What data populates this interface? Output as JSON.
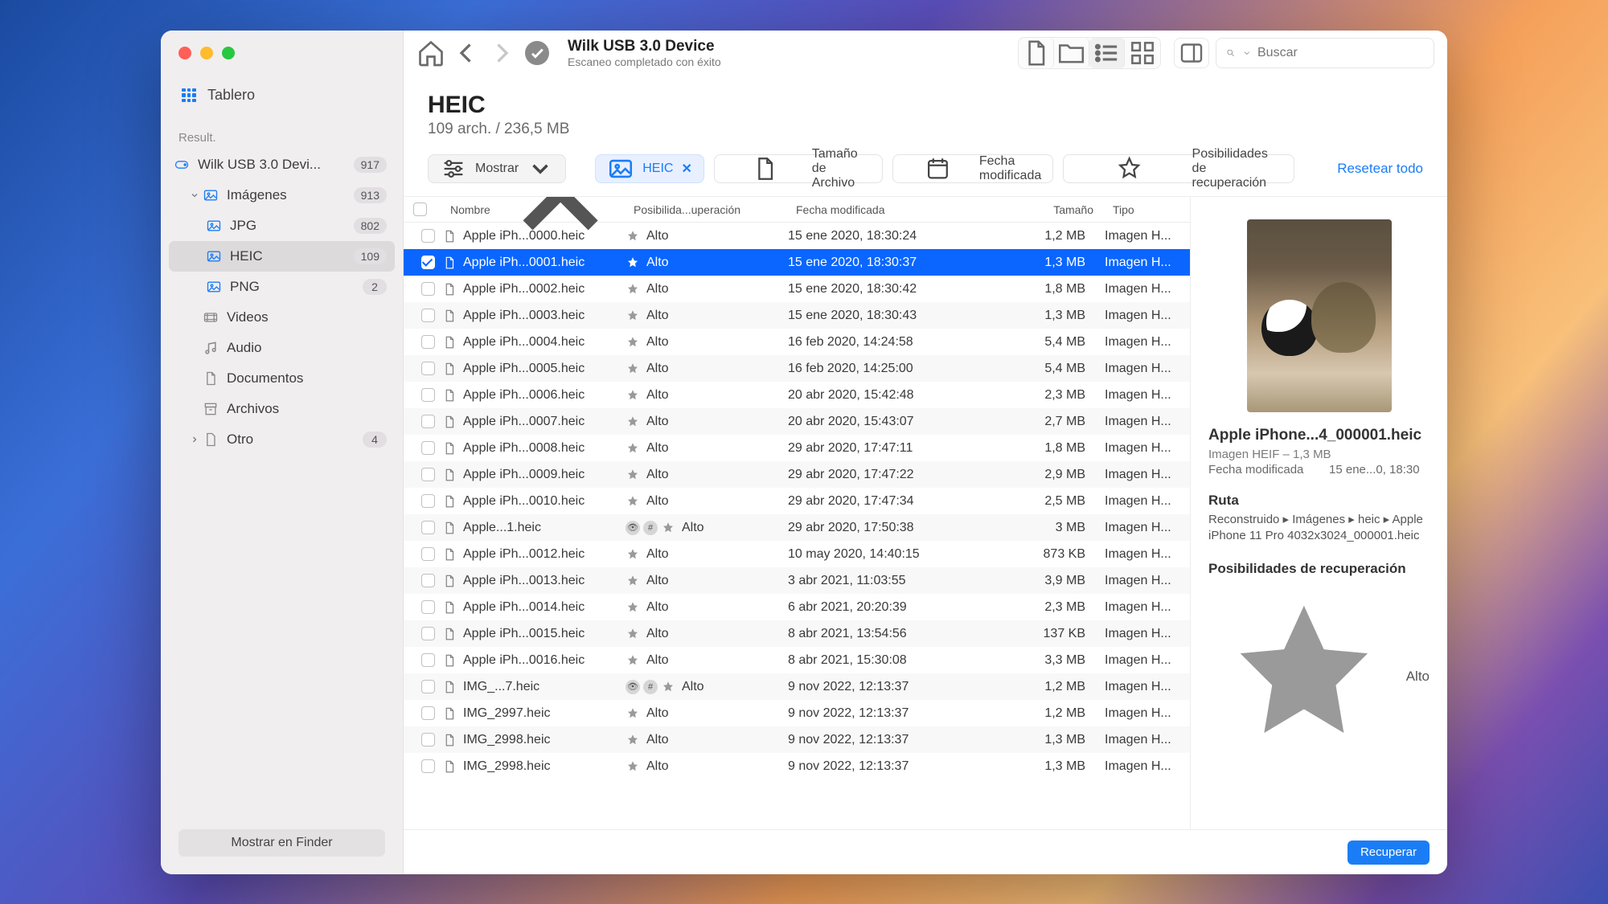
{
  "window": {
    "title": "Wilk USB 3.0 Device",
    "subtitle": "Escaneo completado con éxito",
    "search_placeholder": "Buscar"
  },
  "sidebar": {
    "tablero": "Tablero",
    "section": "Result.",
    "items": [
      {
        "label": "Wilk USB 3.0 Devi...",
        "badge": "917",
        "icon": "drive"
      },
      {
        "label": "Imágenes",
        "badge": "913",
        "icon": "image",
        "expanded": true
      },
      {
        "label": "JPG",
        "badge": "802",
        "icon": "image",
        "child": true
      },
      {
        "label": "HEIC",
        "badge": "109",
        "icon": "image",
        "child": true,
        "selected": true
      },
      {
        "label": "PNG",
        "badge": "2",
        "icon": "image",
        "child": true
      },
      {
        "label": "Videos",
        "badge": "",
        "icon": "video"
      },
      {
        "label": "Audio",
        "badge": "",
        "icon": "audio"
      },
      {
        "label": "Documentos",
        "badge": "",
        "icon": "doc"
      },
      {
        "label": "Archivos",
        "badge": "",
        "icon": "archive"
      },
      {
        "label": "Otro",
        "badge": "4",
        "icon": "other",
        "chevron": true
      }
    ],
    "finder_btn": "Mostrar en Finder"
  },
  "heading": {
    "title": "HEIC",
    "stats": "109 arch. / 236,5 MB"
  },
  "filters": {
    "mostrar": "Mostrar",
    "heic": "HEIC",
    "tamano": "Tamaño de Archivo",
    "fecha": "Fecha modificada",
    "posib": "Posibilidades de recuperación",
    "reset": "Resetear todo"
  },
  "columns": {
    "name": "Nombre",
    "poss": "Posibilida...uperación",
    "date": "Fecha modificada",
    "size": "Tamaño",
    "type": "Tipo"
  },
  "poss_label": "Alto",
  "type_label": "Imagen H...",
  "rows": [
    {
      "name": "Apple iPh...0000.heic",
      "date": "15 ene 2020, 18:30:24",
      "size": "1,2 MB"
    },
    {
      "name": "Apple iPh...0001.heic",
      "date": "15 ene 2020, 18:30:37",
      "size": "1,3 MB",
      "selected": true,
      "checked": true
    },
    {
      "name": "Apple iPh...0002.heic",
      "date": "15 ene 2020, 18:30:42",
      "size": "1,8 MB"
    },
    {
      "name": "Apple iPh...0003.heic",
      "date": "15 ene 2020, 18:30:43",
      "size": "1,3 MB"
    },
    {
      "name": "Apple iPh...0004.heic",
      "date": "16 feb 2020, 14:24:58",
      "size": "5,4 MB"
    },
    {
      "name": "Apple iPh...0005.heic",
      "date": "16 feb 2020, 14:25:00",
      "size": "5,4 MB"
    },
    {
      "name": "Apple iPh...0006.heic",
      "date": "20 abr 2020, 15:42:48",
      "size": "2,3 MB"
    },
    {
      "name": "Apple iPh...0007.heic",
      "date": "20 abr 2020, 15:43:07",
      "size": "2,7 MB"
    },
    {
      "name": "Apple iPh...0008.heic",
      "date": "29 abr 2020, 17:47:11",
      "size": "1,8 MB"
    },
    {
      "name": "Apple iPh...0009.heic",
      "date": "29 abr 2020, 17:47:22",
      "size": "2,9 MB"
    },
    {
      "name": "Apple iPh...0010.heic",
      "date": "29 abr 2020, 17:47:34",
      "size": "2,5 MB"
    },
    {
      "name": "Apple...1.heic",
      "date": "29 abr 2020, 17:50:38",
      "size": "3 MB",
      "badges": true
    },
    {
      "name": "Apple iPh...0012.heic",
      "date": "10 may 2020, 14:40:15",
      "size": "873 KB"
    },
    {
      "name": "Apple iPh...0013.heic",
      "date": "3 abr 2021, 11:03:55",
      "size": "3,9 MB"
    },
    {
      "name": "Apple iPh...0014.heic",
      "date": "6 abr 2021, 20:20:39",
      "size": "2,3 MB"
    },
    {
      "name": "Apple iPh...0015.heic",
      "date": "8 abr 2021, 13:54:56",
      "size": "137 KB"
    },
    {
      "name": "Apple iPh...0016.heic",
      "date": "8 abr 2021, 15:30:08",
      "size": "3,3 MB"
    },
    {
      "name": "IMG_...7.heic",
      "date": "9 nov 2022, 12:13:37",
      "size": "1,2 MB",
      "badges": true
    },
    {
      "name": "IMG_2997.heic",
      "date": "9 nov 2022, 12:13:37",
      "size": "1,2 MB"
    },
    {
      "name": "IMG_2998.heic",
      "date": "9 nov 2022, 12:13:37",
      "size": "1,3 MB"
    },
    {
      "name": "IMG_2998.heic",
      "date": "9 nov 2022, 12:13:37",
      "size": "1,3 MB"
    }
  ],
  "details": {
    "filename": "Apple iPhone...4_000001.heic",
    "subtitle": "Imagen HEIF – 1,3 MB",
    "mod_label": "Fecha modificada",
    "mod_value": "15 ene...0, 18:30",
    "path_label": "Ruta",
    "path_value": "Reconstruido ▸ Imágenes ▸ heic ▸ Apple iPhone 11 Pro 4032x3024_000001.heic",
    "poss_label": "Posibilidades de recuperación",
    "poss_value": "Alto"
  },
  "bottom": {
    "recover": "Recuperar"
  }
}
